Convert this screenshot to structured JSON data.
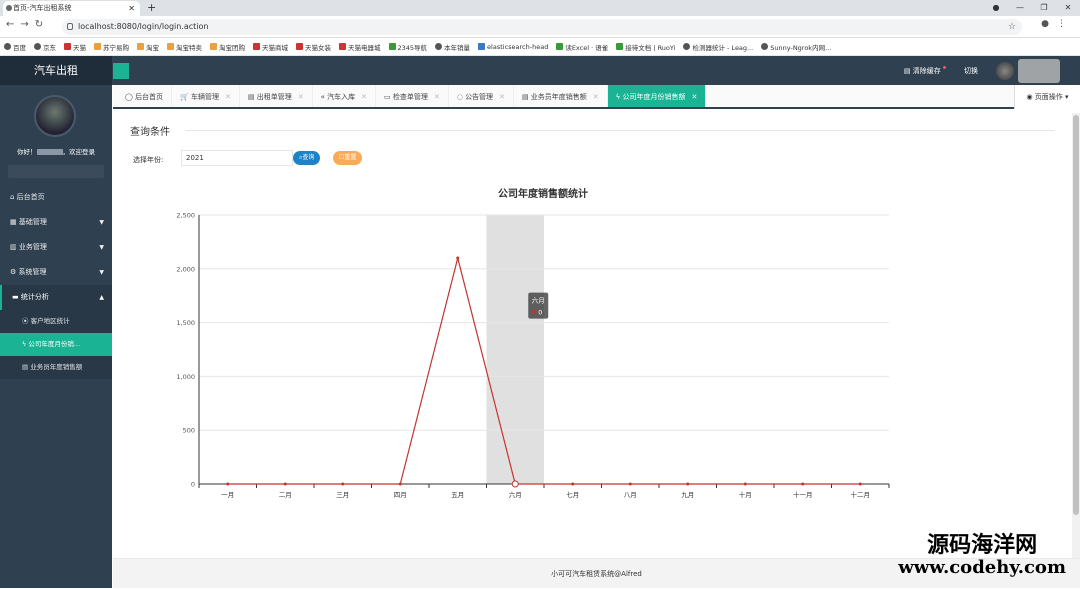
{
  "browser": {
    "tab_title": "首页-汽车出租系统",
    "url": "localhost:8080/login/login.action",
    "bookmarks": [
      "百度",
      "京东",
      "天猫",
      "苏宁易购",
      "淘宝",
      "淘宝特卖",
      "淘宝团购",
      "天猫商城",
      "天猫女装",
      "天猫电器城",
      "2345导航",
      "本年销量",
      "elasticsearch-head",
      "读Excel · 语雀",
      "接待文档 | RuoYi",
      "检测器统计 - Leag...",
      "Sunny-Ngrok内网..."
    ]
  },
  "header": {
    "app_title": "汽车出租",
    "clear_cache": "清除缓存",
    "theme": "切换"
  },
  "sidebar": {
    "welcome_prefix": "你好！",
    "welcome_suffix": "，欢迎登录",
    "items": [
      {
        "label": "后台首页"
      },
      {
        "label": "基础管理"
      },
      {
        "label": "业务管理"
      },
      {
        "label": "系统管理"
      },
      {
        "label": "统计分析"
      }
    ],
    "sub_items": [
      {
        "label": "客户地区统计"
      },
      {
        "label": "公司年度月份销..."
      },
      {
        "label": "业务员年度销售额"
      }
    ]
  },
  "page_tabs": [
    "后台首页",
    "车辆管理",
    "出租单管理",
    "汽车入库",
    "检查单管理",
    "公告管理",
    "业务员年度销售额",
    "公司年度月份销售额"
  ],
  "page_ops": "页面操作",
  "query": {
    "title": "查询条件",
    "year_label": "选择年份:",
    "year_value": "2021",
    "search_btn": "查询",
    "reset_btn": "重置"
  },
  "chart_data": {
    "type": "line",
    "title": "公司年度销售额统计",
    "categories": [
      "一月",
      "二月",
      "三月",
      "四月",
      "五月",
      "六月",
      "七月",
      "八月",
      "九月",
      "十月",
      "十一月",
      "十二月"
    ],
    "values": [
      0,
      0,
      0,
      0,
      2100,
      0,
      0,
      0,
      0,
      0,
      0,
      0
    ],
    "ylim": [
      0,
      2500
    ],
    "yticks": [
      "0",
      "500",
      "1,000",
      "1,500",
      "2,000",
      "2,500"
    ],
    "highlight_index": 5,
    "tooltip": {
      "label": "六月",
      "value": "0"
    },
    "colors": {
      "line": "#c23531",
      "highlight": "#e0e0e0"
    }
  },
  "footer": "小可可汽车租赁系统@Alfred",
  "watermark": {
    "line1": "源码海洋网",
    "line2": "www.codehy.com"
  }
}
